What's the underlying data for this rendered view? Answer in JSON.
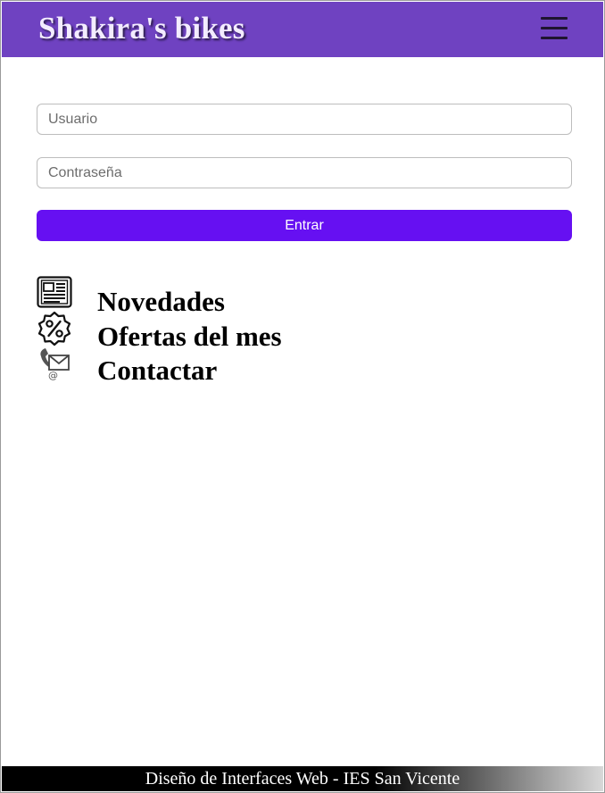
{
  "header": {
    "title": "Shakira's bikes",
    "menu_icon": "hamburger-menu-icon"
  },
  "login": {
    "user_placeholder": "Usuario",
    "password_placeholder": "Contraseña",
    "submit_label": "Entrar"
  },
  "nav": {
    "items": [
      {
        "label": "Novedades",
        "icon": "newspaper-icon"
      },
      {
        "label": "Ofertas del mes",
        "icon": "discount-badge-icon"
      },
      {
        "label": "Contactar",
        "icon": "phone-mail-icon"
      }
    ]
  },
  "footer": {
    "text": "Diseño de Interfaces Web - IES San Vicente"
  },
  "colors": {
    "header_bg": "#6f42c1",
    "button_bg": "#6610f2",
    "footer_bg": "#000000"
  }
}
